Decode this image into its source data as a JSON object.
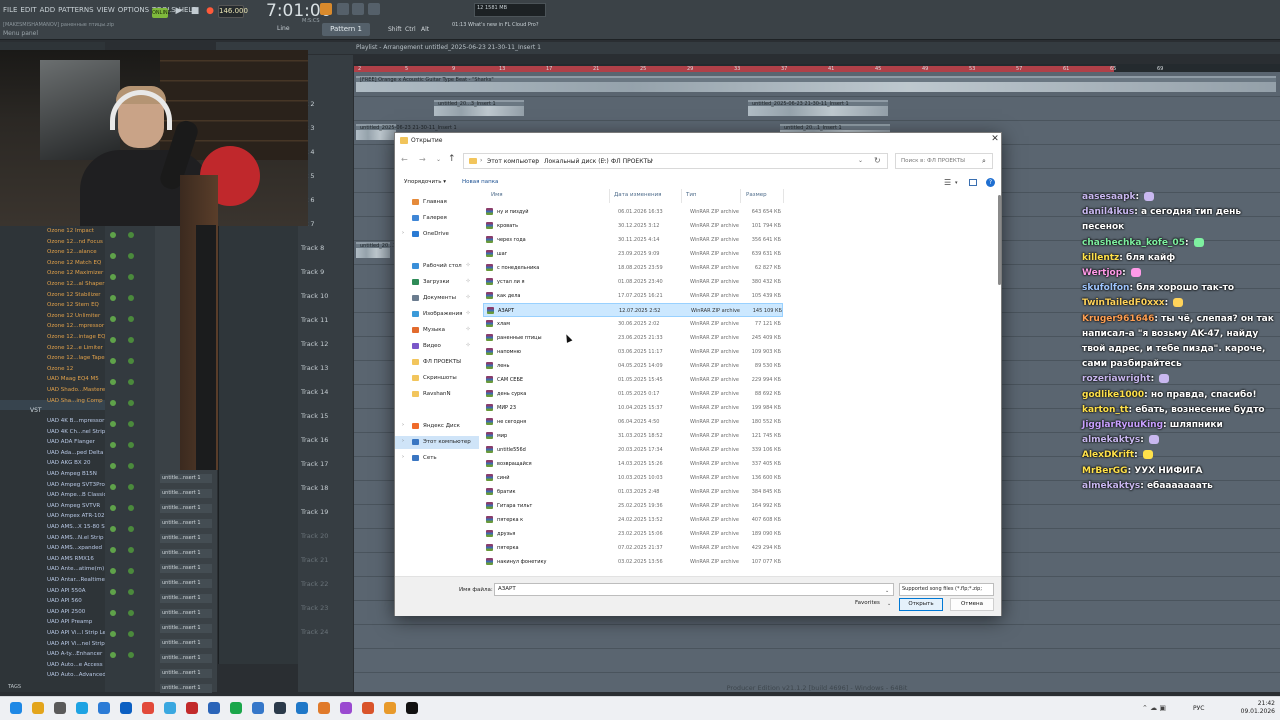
{
  "fl": {
    "menu": [
      "FILE",
      "EDIT",
      "ADD",
      "PATTERNS",
      "VIEW",
      "OPTIONS",
      "TOOLS",
      "HELP"
    ],
    "project_label": "[MAKESMISHAMANOV] раненные птицы.zip",
    "menu_panel": "Menu panel",
    "online": "ONLINE",
    "tempo": "146.000",
    "time": "7:01:00",
    "time_sub": "M:S:CS",
    "line_mode": "Line",
    "pattern": "Pattern 1",
    "shift_label": "Shift",
    "ctrl_label": "Ctrl",
    "alt_label": "Alt",
    "news": "01:13  What's new in FL\nCloud Pro?",
    "cpu": "12   1581 MB",
    "playlist_title": "Playlist - Arrangement  untitled_2025-06-23 21-30-11_Insert 1",
    "browser_label": "Browser",
    "tags": "TAGS",
    "status": "Producer Edition v21.1.2 [build 4696] - Windows - 64Bit",
    "vst_folder": "VST",
    "ozone_plugins": [
      "Ozone 12 Impact",
      "Ozone 12...nd Focus",
      "Ozone 12...alance",
      "Ozone 12 Match EQ",
      "Ozone 12 Maximizer",
      "Ozone 12...al Shaper",
      "Ozone 12 Stabilizer",
      "Ozone 12 Stem EQ",
      "Ozone 12 Unlimiter",
      "Ozone 12...mpressor",
      "Ozone 12...intage EQ",
      "Ozone 12...e Limiter",
      "Ozone 12...lage Tape",
      "Ozone 12",
      "UAD Maag EQ4 M5",
      "UAD Shado...Mastere",
      "UAD Sha...ing Comp"
    ],
    "uad_plugins": [
      "UAD 4K B...mpressor",
      "UAD 4K Ch...nel Strip",
      "UAD ADA Flanger",
      "UAD Ada...ped Delta",
      "UAD AKG BX 20",
      "UAD Ampeg B15N",
      "UAD Ampeg SVT3Pro",
      "UAD Ampe...B Classic",
      "UAD Ampeg SVTVR",
      "UAD Ampex ATR-102",
      "UAD AMS...X 15-80 S",
      "UAD AMS...N.el Strip",
      "UAD AMS...xpanded",
      "UAD AMS RMX16",
      "UAD Ante...atime(m)",
      "UAD Antar...Realtime",
      "UAD API 550A",
      "UAD API 560",
      "UAD API 2500",
      "UAD API Preamp",
      "UAD API Vi...l Strip Le",
      "UAD API Vi...nel Strip",
      "UAD A-ty...Enhancer",
      "UAD Auto...e Access",
      "UAD Auto...Advanced"
    ],
    "tracks": [
      "ck 2",
      "ck 3",
      "ck 4",
      "ck 5",
      "ck 6",
      "ck 7",
      "Track 8",
      "Track 9",
      "Track 10",
      "Track 11",
      "Track 12",
      "Track 13",
      "Track 14",
      "Track 15",
      "Track 16",
      "Track 17",
      "Track 18",
      "Track 19",
      "Track 20",
      "Track 21",
      "Track 22",
      "Track 23",
      "Track 24"
    ],
    "ruler": [
      "2",
      "5",
      "9",
      "13",
      "17",
      "21",
      "25",
      "29",
      "33",
      "37",
      "41",
      "45",
      "49",
      "53",
      "57",
      "61",
      "65",
      "69"
    ],
    "insert_slot": "untitle...nsert 1",
    "clip_labels": [
      "[FREE] Orange x Acoustic Guitar Type Beat - \"Sharks\"",
      "untitled_20...3_Insert 1",
      "untitled_2025-06-23 21-30-11_Insert 1",
      "untitled_20...1_Insert 1",
      "untitled_2025-06-23 21-30-11_Insert 1",
      "untitled_2025-...",
      "untitled_20...1"
    ]
  },
  "chat": [
    {
      "user": "aasesaapk",
      "color": "#c9b8f0",
      "text": ""
    },
    {
      "user": "danil4ikus",
      "color": "#c9b8f0",
      "text": "а сегодня тип день песенок"
    },
    {
      "user": "chashechka_kofe_05",
      "color": "#7ef0a0",
      "text": ""
    },
    {
      "user": "killentz",
      "color": "#ffe14a",
      "text": "бля кайф"
    },
    {
      "user": "Wertjop",
      "color": "#ff9ae8",
      "text": ""
    },
    {
      "user": "skufolfon",
      "color": "#9fc6ff",
      "text": "бля хорошо так-то"
    },
    {
      "user": "TwinTailedF0xxx",
      "color": "#ffd35a",
      "text": ""
    },
    {
      "user": "Kruger961646",
      "color": "#ff9f52",
      "text": "ты чё, слепая? он так написал-а \"я возьму AK-47, найду твой адрес, и тебе пизда\". кароче, сами разбирайтесь"
    },
    {
      "user": "rozeriawright",
      "color": "#c9b8f0",
      "text": ""
    },
    {
      "user": "godlike1000",
      "color": "#ffe14a",
      "text": "но правда, спасибо!"
    },
    {
      "user": "karton_tt",
      "color": "#ffe14a",
      "text": "ебать, вознесение будто"
    },
    {
      "user": "JigglarRyuuKing",
      "color": "#c8a0ff",
      "text": "шляпники"
    },
    {
      "user": "almekaktys",
      "color": "#c9b8f0",
      "text": ""
    },
    {
      "user": "AlexDKrift",
      "color": "#ffe14a",
      "text": ""
    },
    {
      "user": "MrBerGG",
      "color": "#ffe14a",
      "text": "УУХ НИФИГА"
    },
    {
      "user": "almekaktys",
      "color": "#c9b8f0",
      "text": "ебааааааать"
    }
  ],
  "dialog": {
    "title": "Открытие",
    "breadcrumbs": [
      "Этот компьютер",
      "Локальный диск (E:)",
      "ФЛ ПРОЕКТЫ"
    ],
    "search_placeholder": "Поиск в: ФЛ ПРОЕКТЫ",
    "organize": "Упорядочить ▾",
    "new_folder": "Новая папка",
    "columns": {
      "name": "Имя",
      "date": "Дата изменения",
      "type": "Тип",
      "size": "Размер"
    },
    "nav": [
      {
        "label": "Главная",
        "icon_color": "#e58a3a",
        "pin": ""
      },
      {
        "label": "Галерея",
        "icon_color": "#3f86d6",
        "pin": ""
      },
      {
        "label": "OneDrive",
        "icon_color": "#2a7bd4",
        "pin": "",
        "arrow": "›"
      },
      {
        "label": "Рабочий стол",
        "icon_color": "#3a8fd9",
        "pin": "📌"
      },
      {
        "label": "Загрузки",
        "icon_color": "#2e8b57",
        "pin": "📌"
      },
      {
        "label": "Документы",
        "icon_color": "#6b7c8f",
        "pin": "📌"
      },
      {
        "label": "Изображения",
        "icon_color": "#3b9ad9",
        "pin": "📌"
      },
      {
        "label": "Музыка",
        "icon_color": "#e26b2e",
        "pin": "📌"
      },
      {
        "label": "Видео",
        "icon_color": "#7a57c9",
        "pin": "📌"
      },
      {
        "label": "ФЛ ПРОЕКТЫ",
        "icon_color": "#f2c55c",
        "pin": ""
      },
      {
        "label": "Скриншоты",
        "icon_color": "#f2c55c",
        "pin": ""
      },
      {
        "label": "RavshanN",
        "icon_color": "#f2c55c",
        "pin": ""
      },
      {
        "label": "Яндекс Диск",
        "icon_color": "#ef6b2a",
        "pin": "",
        "arrow": "›"
      },
      {
        "label": "Этот компьютер",
        "icon_color": "#3a76c2",
        "pin": "",
        "arrow": "›"
      },
      {
        "label": "Сеть",
        "icon_color": "#3a76c2",
        "pin": "",
        "arrow": "›"
      }
    ],
    "files": [
      {
        "name": "ну и пиздуй",
        "date": "06.01.2026 16:33",
        "type": "WinRAR ZIP archive",
        "size": "643 654 КБ"
      },
      {
        "name": "кровать",
        "date": "30.12.2025 3:12",
        "type": "WinRAR ZIP archive",
        "size": "101 794 КБ"
      },
      {
        "name": "через года",
        "date": "30.11.2025 4:14",
        "type": "WinRAR ZIP archive",
        "size": "356 641 КБ"
      },
      {
        "name": "шаг",
        "date": "23.09.2025 9:09",
        "type": "WinRAR ZIP archive",
        "size": "639 631 КБ"
      },
      {
        "name": "с понедельника",
        "date": "18.08.2025 23:59",
        "type": "WinRAR ZIP archive",
        "size": "62 827 КБ"
      },
      {
        "name": "устал ли я",
        "date": "01.08.2025 23:40",
        "type": "WinRAR ZIP archive",
        "size": "380 432 КБ"
      },
      {
        "name": "как дела",
        "date": "17.07.2025 16:21",
        "type": "WinRAR ZIP archive",
        "size": "105 439 КБ"
      },
      {
        "name": "АЗАРТ",
        "date": "12.07.2025 2:52",
        "type": "WinRAR ZIP archive",
        "size": "145 109 КБ",
        "selected": true
      },
      {
        "name": "хлам",
        "date": "30.06.2025 2:02",
        "type": "WinRAR ZIP archive",
        "size": "77 121 КБ"
      },
      {
        "name": "раненные птицы",
        "date": "23.06.2025 21:33",
        "type": "WinRAR ZIP archive",
        "size": "245 409 КБ"
      },
      {
        "name": "напомню",
        "date": "03.06.2025 11:17",
        "type": "WinRAR ZIP archive",
        "size": "109 903 КБ"
      },
      {
        "name": "лень",
        "date": "04.05.2025 14:09",
        "type": "WinRAR ZIP archive",
        "size": "89 530 КБ"
      },
      {
        "name": "САМ СЕБЕ",
        "date": "01.05.2025 15:45",
        "type": "WinRAR ZIP archive",
        "size": "229 994 КБ"
      },
      {
        "name": "день сурка",
        "date": "01.05.2025 0:17",
        "type": "WinRAR ZIP archive",
        "size": "88 692 КБ"
      },
      {
        "name": "МИР 23",
        "date": "10.04.2025 15:37",
        "type": "WinRAR ZIP archive",
        "size": "199 984 КБ"
      },
      {
        "name": "не сегодня",
        "date": "06.04.2025 4:50",
        "type": "WinRAR ZIP archive",
        "size": "180 552 КБ"
      },
      {
        "name": "мир",
        "date": "31.03.2025 18:52",
        "type": "WinRAR ZIP archive",
        "size": "121 745 КБ"
      },
      {
        "name": "untitle556d",
        "date": "20.03.2025 17:34",
        "type": "WinRAR ZIP archive",
        "size": "339 106 КБ"
      },
      {
        "name": "возвращайся",
        "date": "14.03.2025 15:26",
        "type": "WinRAR ZIP archive",
        "size": "337 405 КБ"
      },
      {
        "name": "синй",
        "date": "10.03.2025 10:03",
        "type": "WinRAR ZIP archive",
        "size": "136 600 КБ"
      },
      {
        "name": "братик",
        "date": "01.03.2025 2:48",
        "type": "WinRAR ZIP archive",
        "size": "384 845 КБ"
      },
      {
        "name": "Гитара тильт",
        "date": "25.02.2025 19:36",
        "type": "WinRAR ZIP archive",
        "size": "164 992 КБ"
      },
      {
        "name": "пятерка к",
        "date": "24.02.2025 13:52",
        "type": "WinRAR ZIP archive",
        "size": "407 608 КБ"
      },
      {
        "name": "друзья",
        "date": "23.02.2025 15:06",
        "type": "WinRAR ZIP archive",
        "size": "189 090 КБ"
      },
      {
        "name": "пятерка",
        "date": "07.02.2025 21:37",
        "type": "WinRAR ZIP archive",
        "size": "429 294 КБ"
      },
      {
        "name": "накинул фонетику",
        "date": "03.02.2025 13:56",
        "type": "WinRAR ZIP archive",
        "size": "107 077 КБ"
      },
      {
        "name": "",
        "date": "",
        "type": "",
        "size": ""
      }
    ],
    "filename_label": "Имя файла:",
    "filename_value": "АЗАРТ",
    "filetype": "Supported song files (*.flp;*.zip;",
    "favorites": "Favorites",
    "open": "Открыть",
    "cancel": "Отмена"
  },
  "taskbar": {
    "lang": "РУС",
    "time": "21:42",
    "date": "09.01.2026"
  }
}
